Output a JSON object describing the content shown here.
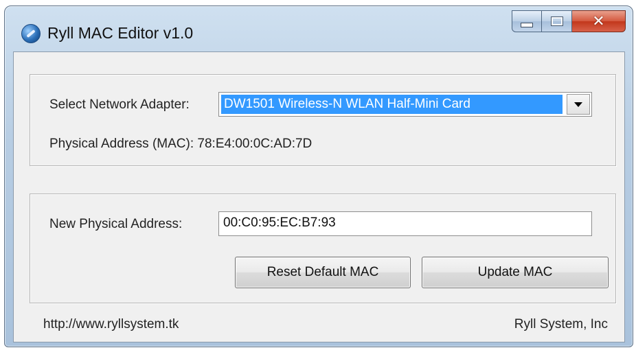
{
  "window": {
    "title": "Ryll MAC Editor v1.0",
    "icon": "globe-app-icon",
    "controls": {
      "minimize": "minimize-icon",
      "maximize": "maximize-icon",
      "close": "✕"
    }
  },
  "adapter": {
    "label": "Select Network Adapter:",
    "selected": "DW1501 Wireless-N WLAN Half-Mini Card",
    "mac_label": "Physical Address (MAC):",
    "mac_value": "78:E4:00:0C:AD:7D"
  },
  "new_address": {
    "label": "New Physical Address:",
    "value": "00:C0:95:EC:B7:93",
    "reset_button": "Reset Default MAC",
    "update_button": "Update MAC"
  },
  "footer": {
    "url": "http://www.ryllsystem.tk",
    "company": "Ryll System, Inc"
  },
  "colors": {
    "selection": "#3399ff",
    "close_button": "#c2371b",
    "frame": "#b7cde3"
  }
}
